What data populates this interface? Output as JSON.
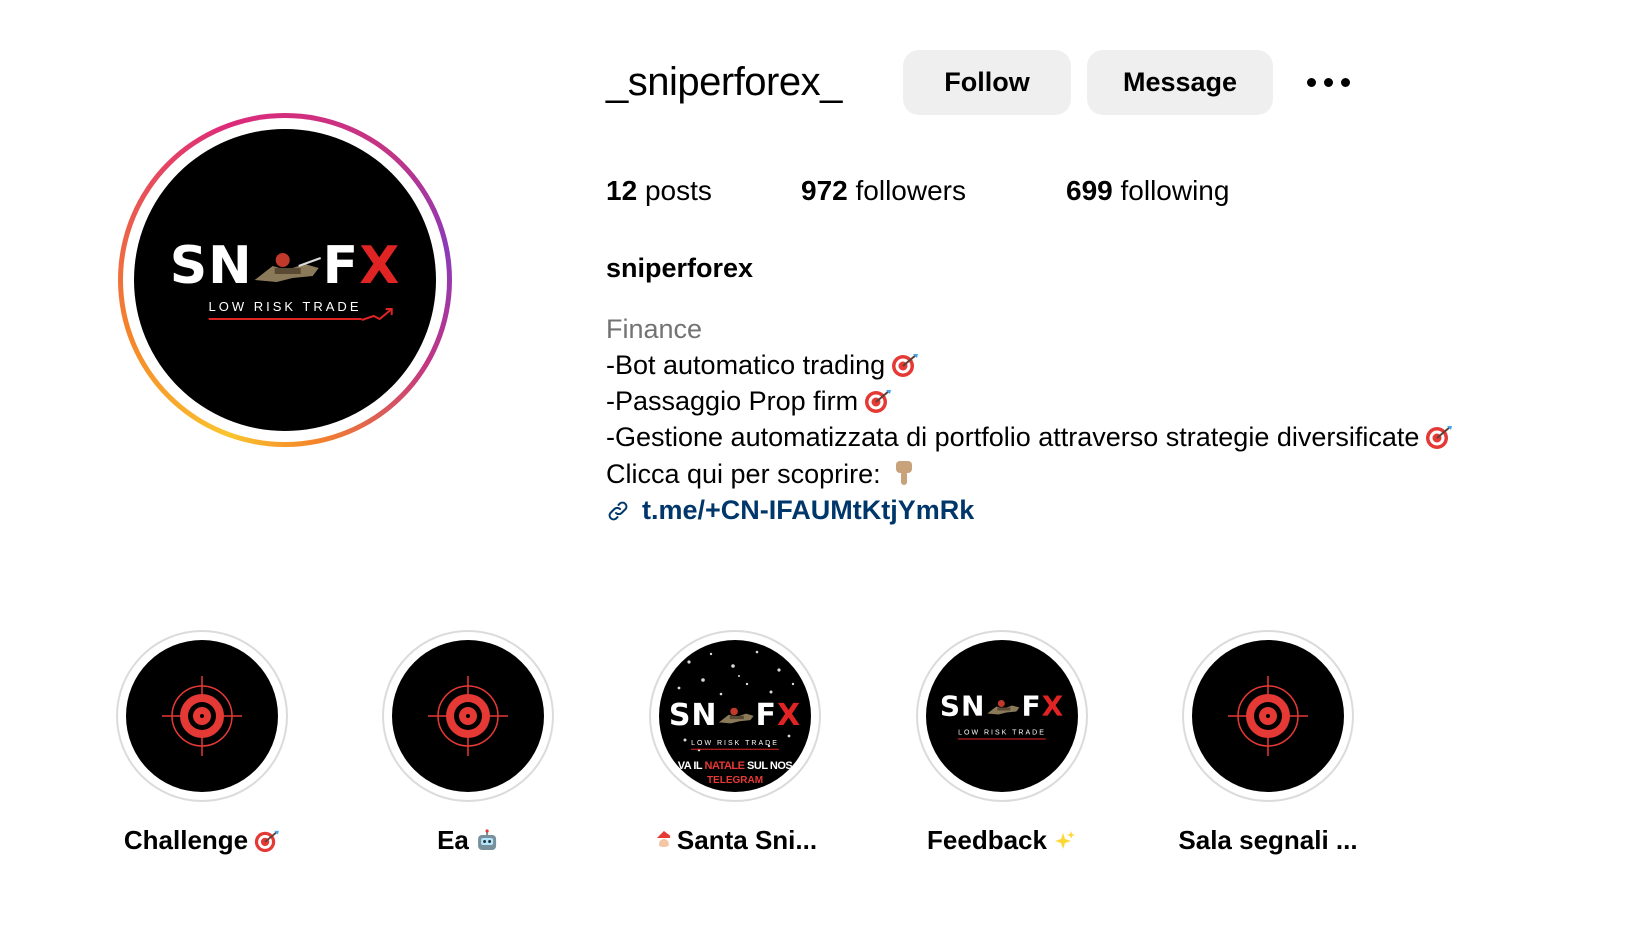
{
  "header": {
    "username": "_sniperforex_",
    "follow_label": "Follow",
    "message_label": "Message"
  },
  "stats": {
    "posts_count": "12",
    "posts_label": "posts",
    "followers_count": "972",
    "followers_label": "followers",
    "following_count": "699",
    "following_label": "following"
  },
  "bio": {
    "full_name": "sniperforex",
    "category": "Finance",
    "lines": [
      "-Bot automatico trading",
      "-Passaggio Prop firm",
      "-Gestione automatizzata di portfolio attraverso strategie diversificate",
      "Clicca qui per scoprire:"
    ],
    "link_text": "t.me/+CN-IFAUMtKtjYmRk"
  },
  "logo": {
    "word_left": "SN",
    "word_right": "F",
    "word_x": "X",
    "tagline": "LOW RISK TRADE"
  },
  "highlights": [
    {
      "label": "Challenge",
      "emoji_icon": "direct-hit-icon"
    },
    {
      "label": "Ea",
      "emoji_icon": "robot-icon"
    },
    {
      "label": "Santa Sni...",
      "emoji_icon": "santa-icon",
      "banner_prefix": "VA IL ",
      "banner_red": "NATALE",
      "banner_suffix": " SUL NOS",
      "banner_line2": "TELEGRAM"
    },
    {
      "label": "Feedback",
      "emoji_icon": "sparkles-icon"
    },
    {
      "label": "Sala segnali ...",
      "emoji_icon": ""
    }
  ],
  "colors": {
    "link": "#00376b",
    "muted": "#737373",
    "button_bg": "#efefef",
    "logo_red": "#e02424"
  }
}
